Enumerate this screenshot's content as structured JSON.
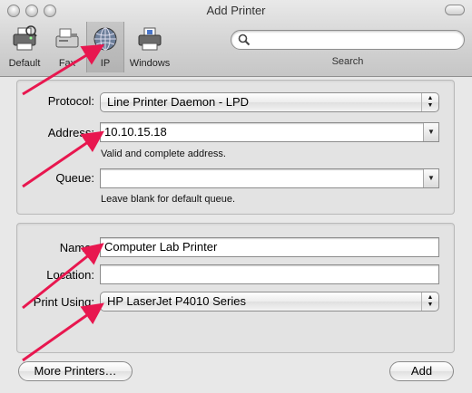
{
  "window": {
    "title": "Add Printer"
  },
  "toolbar": {
    "items": [
      {
        "label": "Default",
        "icon": "printer-icon"
      },
      {
        "label": "Fax",
        "icon": "fax-icon"
      },
      {
        "label": "IP",
        "icon": "globe-icon",
        "selected": true
      },
      {
        "label": "Windows",
        "icon": "windows-printer-icon"
      }
    ],
    "search": {
      "label": "Search",
      "value": ""
    }
  },
  "ip_settings": {
    "protocol": {
      "label": "Protocol:",
      "value": "Line Printer Daemon - LPD"
    },
    "address": {
      "label": "Address:",
      "value": "10.10.15.18",
      "note": "Valid and complete address."
    },
    "queue": {
      "label": "Queue:",
      "value": "",
      "note": "Leave blank for default queue."
    }
  },
  "printer_settings": {
    "name": {
      "label": "Name:",
      "value": "Computer Lab Printer"
    },
    "location": {
      "label": "Location:",
      "value": ""
    },
    "print_using": {
      "label": "Print Using:",
      "value": "HP LaserJet P4010 Series"
    }
  },
  "buttons": {
    "more_printers": "More Printers…",
    "add": "Add"
  },
  "annotation_color": "#e8174f"
}
